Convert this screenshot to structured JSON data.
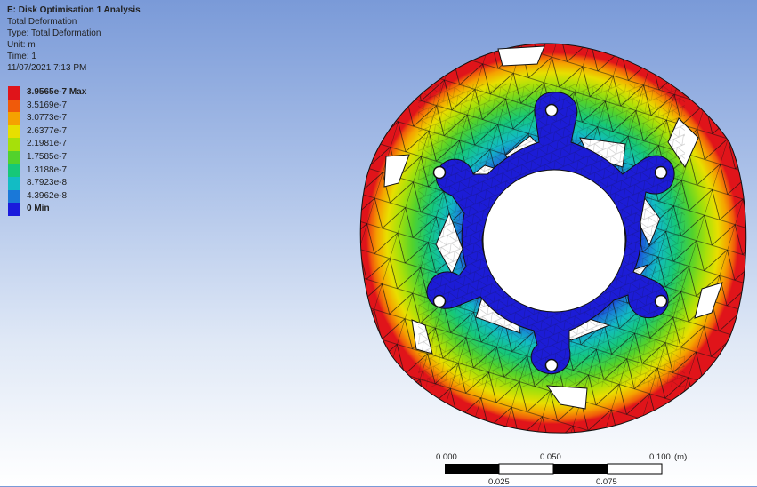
{
  "header": {
    "title": "E: Disk Optimisation 1 Analysis",
    "result_name": "Total Deformation",
    "result_type": "Type: Total Deformation",
    "unit": "Unit: m",
    "time": "Time: 1",
    "timestamp": "11/07/2021 7:13 PM"
  },
  "legend": [
    {
      "label": "3.9565e-7 Max",
      "color": "#e0141a",
      "bold": true
    },
    {
      "label": "3.5169e-7",
      "color": "#f05a0a",
      "bold": false
    },
    {
      "label": "3.0773e-7",
      "color": "#f5a200",
      "bold": false
    },
    {
      "label": "2.6377e-7",
      "color": "#e8df00",
      "bold": false
    },
    {
      "label": "2.1981e-7",
      "color": "#a6e00a",
      "bold": false
    },
    {
      "label": "1.7585e-7",
      "color": "#52d22c",
      "bold": false
    },
    {
      "label": "1.3188e-7",
      "color": "#16c878",
      "bold": false
    },
    {
      "label": "8.7923e-8",
      "color": "#12bcc4",
      "bold": false
    },
    {
      "label": "4.3962e-8",
      "color": "#1a78d8",
      "bold": false
    },
    {
      "label": "0 Min",
      "color": "#1a1adc",
      "bold": true
    }
  ],
  "scale": {
    "top_labels": [
      "0.000",
      "0.050",
      "0.100"
    ],
    "bottom_labels": [
      "0.025",
      "0.075"
    ],
    "unit": "(m)"
  }
}
